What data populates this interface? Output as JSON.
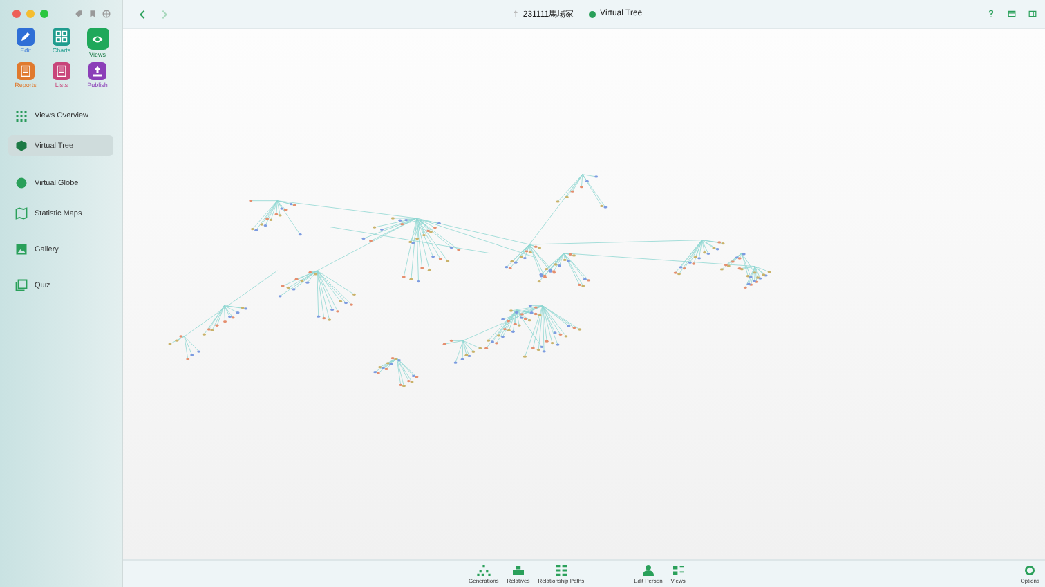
{
  "window": {
    "title": "231111馬場家",
    "view": "Virtual Tree"
  },
  "sidebar": {
    "apps": [
      {
        "label": "Edit",
        "color": "#2f6fd6",
        "selected": false
      },
      {
        "label": "Charts",
        "color": "#1f9c8e",
        "selected": false
      },
      {
        "label": "Views",
        "color": "#1fa85a",
        "selected": true
      },
      {
        "label": "Reports",
        "color": "#e07a2e",
        "selected": false
      },
      {
        "label": "Lists",
        "color": "#c8457a",
        "selected": false
      },
      {
        "label": "Publish",
        "color": "#8b3fb8",
        "selected": false
      }
    ],
    "items": [
      {
        "label": "Views Overview",
        "selected": false
      },
      {
        "label": "Virtual Tree",
        "selected": true
      },
      {
        "label": "Virtual Globe",
        "selected": false
      },
      {
        "label": "Statistic Maps",
        "selected": false
      },
      {
        "label": "Gallery",
        "selected": false
      },
      {
        "label": "Quiz",
        "selected": false
      }
    ]
  },
  "bottom_bar": {
    "tools": [
      {
        "label": "Generations"
      },
      {
        "label": "Relatives"
      },
      {
        "label": "Relationship Paths"
      },
      {
        "label": "Edit Person"
      },
      {
        "label": "Views"
      }
    ],
    "options": "Options"
  }
}
